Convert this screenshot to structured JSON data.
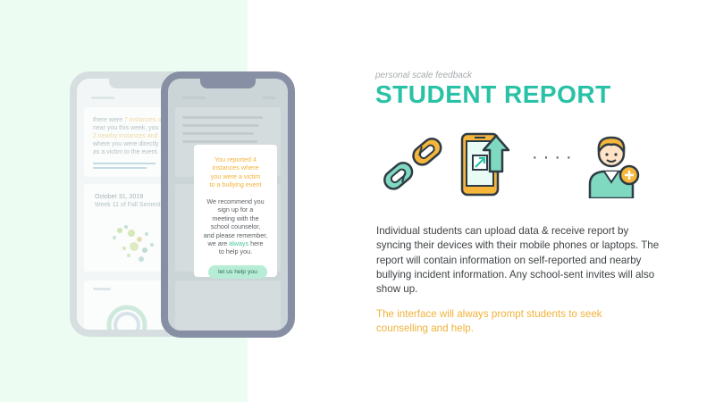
{
  "header": {
    "subtitle": "personal scale feedback",
    "title": "STUDENT REPORT"
  },
  "icons": {
    "link": "broken-chain-link-icon",
    "phone": "smartphone-upload-icon",
    "dots": "····",
    "student": "student-add-icon"
  },
  "body": {
    "description": "Individual students can upload data & receive report by syncing their devices with their mobile phones or laptops. The report will contain information on self-reported and nearby bullying incident information. Any school-sent invites will also show up.",
    "note": "The interface will always prompt students to seek counselling and help."
  },
  "back_phone": {
    "lines": [
      "there were",
      "near you this week, you re",
      "",
      "where you were directly in",
      "as a victim to the event."
    ],
    "highlight": [
      "7 instances of bul",
      "2 nearby instances and 1"
    ],
    "date": "October 31, 2019",
    "week": "Week 11 of Fall Semeste"
  },
  "front_phone": {
    "popup_alert": [
      "You reported 4",
      "instances where",
      "you were a victim",
      "to a bullying event"
    ],
    "popup_rec": [
      "We recommend you",
      "sign up for a",
      "meeting with the",
      "school counselor,"
    ],
    "popup_rec_tail_pre": "and please remember,",
    "popup_rec_we": "we are",
    "popup_rec_always": "always",
    "popup_rec_here": "here",
    "popup_rec_last": "to help you.",
    "button": "let us help you"
  },
  "colors": {
    "accent": "#29c2a6",
    "highlight": "#f0b23a",
    "left_panel": "#edfcf3"
  }
}
